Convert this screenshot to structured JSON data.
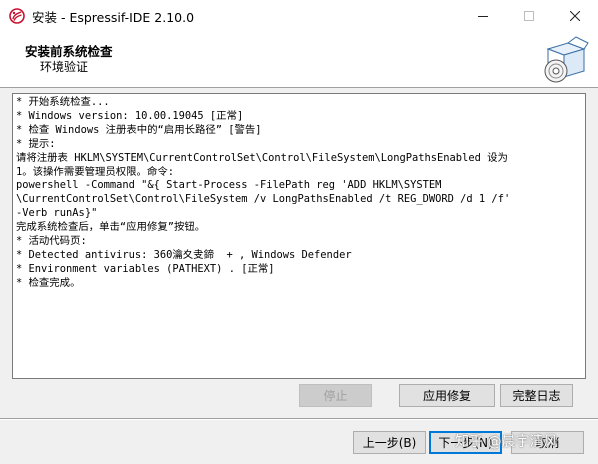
{
  "window": {
    "title": "安装 - Espressif-IDE 2.10.0",
    "minimize_glyph": "—",
    "maximize_glyph": "☐",
    "close_glyph": "✕"
  },
  "header": {
    "title": "安装前系统检查",
    "subtitle": "环境验证"
  },
  "log": {
    "lines": [
      "* 开始系统检查...",
      "* Windows version: 10.00.19045 [正常]",
      "* 检查 Windows 注册表中的“启用长路径” [警告]",
      "* 提示:",
      "请将注册表 HKLM\\SYSTEM\\CurrentControlSet\\Control\\FileSystem\\LongPathsEnabled 设为",
      "1。该操作需要管理员权限。命令:",
      "powershell -Command \"&{ Start-Process -FilePath reg 'ADD HKLM\\SYSTEM",
      "\\CurrentControlSet\\Control\\FileSystem /v LongPathsEnabled /t REG_DWORD /d 1 /f'",
      "-Verb runAs}\"",
      "完成系统检查后，单击“应用修复”按钮。",
      "* 活动代码页:",
      "* Detected antivirus: 360瀹夊叏鍗  + , Windows Defender",
      "* Environment variables (PATHEXT) . [正常]",
      "* 检查完成。"
    ]
  },
  "buttons": {
    "stop": "停止",
    "apply_fix": "应用修复",
    "full_log": "完整日志",
    "back": "上一步(B)",
    "next": "下一步(N)",
    "cancel": "取消"
  },
  "watermark": "知乎 @晨宇清风",
  "colors": {
    "accent": "#0078d7",
    "dialog_bg": "#f0f0f0",
    "icon_red": "#c8102e"
  }
}
